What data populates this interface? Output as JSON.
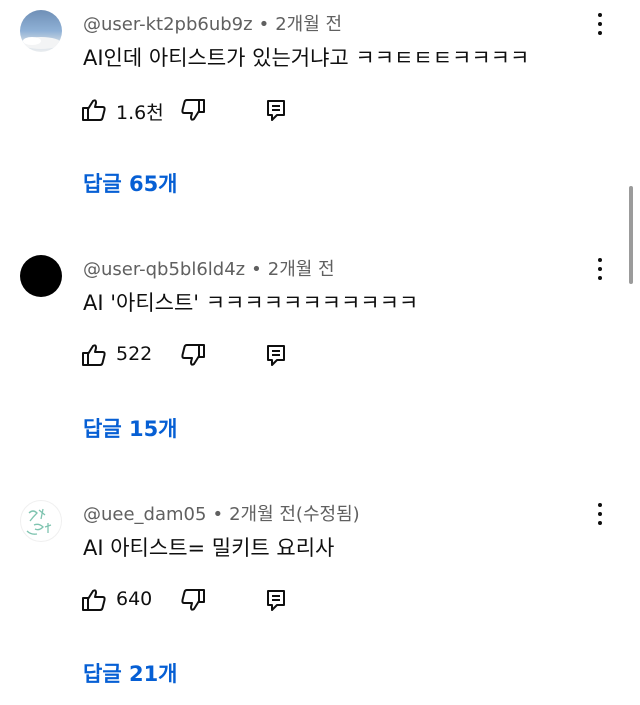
{
  "comments": [
    {
      "author": "@user-kt2pb6ub9z",
      "time": "2개월 전",
      "text": "AI인데 아티스트가 있는거냐고 ㅋㅋㅌㅌㅌㅋㅋㅋㅋ",
      "likes": "1.6천",
      "replies": "답글 65개",
      "avatar": "sky-photo-avatar"
    },
    {
      "author": "@user-qb5bl6ld4z",
      "time": "2개월 전",
      "text": "AI '아티스트' ㅋㅋㅋㅋㅋㅋㅋㅋㅋㅋㅋ",
      "likes": "522",
      "replies": "답글 15개",
      "avatar": "black-avatar"
    },
    {
      "author": "@uee_dam05",
      "time": "2개월 전(수정됨)",
      "text": "AI 아티스트= 밀키트 요리사",
      "likes": "640",
      "replies": "답글 21개",
      "avatar": "doodle-avatar"
    }
  ],
  "icons": {
    "like": "thumbs-up-icon",
    "dislike": "thumbs-down-icon",
    "reply": "reply-comment-icon",
    "more": "more-vertical-icon"
  },
  "colors": {
    "link": "#065fd4",
    "meta": "#606060",
    "text": "#0f0f0f"
  }
}
